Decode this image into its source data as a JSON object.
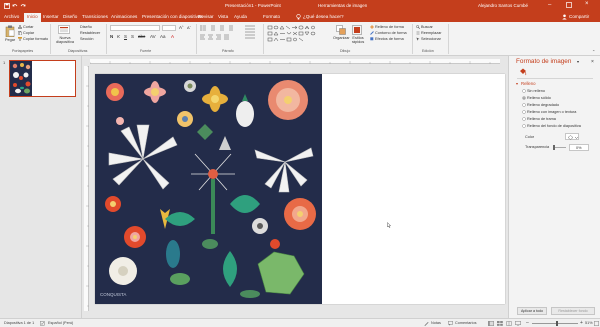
{
  "titlebar": {
    "center_title": "Presentación1 - PowerPoint",
    "context_title": "Herramientas de imagen",
    "user": "Alejandro Santos Cumbé",
    "quick_access": [
      "save-icon",
      "undo-icon",
      "redo-icon"
    ]
  },
  "tabs": [
    {
      "label": "Archivo"
    },
    {
      "label": "Inicio",
      "active": true
    },
    {
      "label": "Insertar"
    },
    {
      "label": "Diseño"
    },
    {
      "label": "Transiciones"
    },
    {
      "label": "Animaciones"
    },
    {
      "label": "Presentación con diapositivas"
    },
    {
      "label": "Revisar"
    },
    {
      "label": "Vista"
    },
    {
      "label": "Ayuda"
    },
    {
      "label": "Formato"
    },
    {
      "label": "¿Qué desea hacer?"
    }
  ],
  "share_label": "Compartir",
  "ribbon": {
    "clipboard": {
      "paste": "Pegar",
      "cut": "Cortar",
      "copy": "Copiar",
      "format_painter": "Copiar formato",
      "group": "Portapapeles"
    },
    "slides": {
      "new_slide": "Nueva diapositiva",
      "layout": "Diseño",
      "reset": "Restablecer",
      "section": "Sección",
      "group": "Diapositivas"
    },
    "font": {
      "group": "Fuente"
    },
    "paragraph": {
      "group": "Párrafo"
    },
    "drawing": {
      "arrange": "Organizar",
      "quick_styles": "Estilos rápidos",
      "fill": "Relleno de forma",
      "outline": "Contorno de forma",
      "effects": "Efectos de forma",
      "group": "Dibujo"
    },
    "editing": {
      "find": "Buscar",
      "replace": "Reemplazar",
      "select": "Seleccionar",
      "group": "Edición"
    }
  },
  "thumb_number": "1",
  "pane": {
    "title": "Formato de imagen",
    "section": "Relleno",
    "options": [
      "Sin relleno",
      "Relleno sólido",
      "Relleno degradado",
      "Relleno con imagen o textura",
      "Relleno de trama",
      "Relleno del fondo de diapositiva"
    ],
    "color_label": "Color",
    "transparency_label": "Transparencia",
    "transparency_value": "0%",
    "apply_all": "Aplicar a todo",
    "reset_background": "Restablecer fondo"
  },
  "image_caption": "CONQUISTA",
  "status": {
    "slide_info": "Diapositiva 1 de 1",
    "language": "Español (Perú)",
    "notes": "Notas",
    "comments": "Comentarios",
    "zoom": "51%"
  },
  "colors": {
    "accent": "#c43e1c",
    "image_bg": "#232c4a"
  }
}
